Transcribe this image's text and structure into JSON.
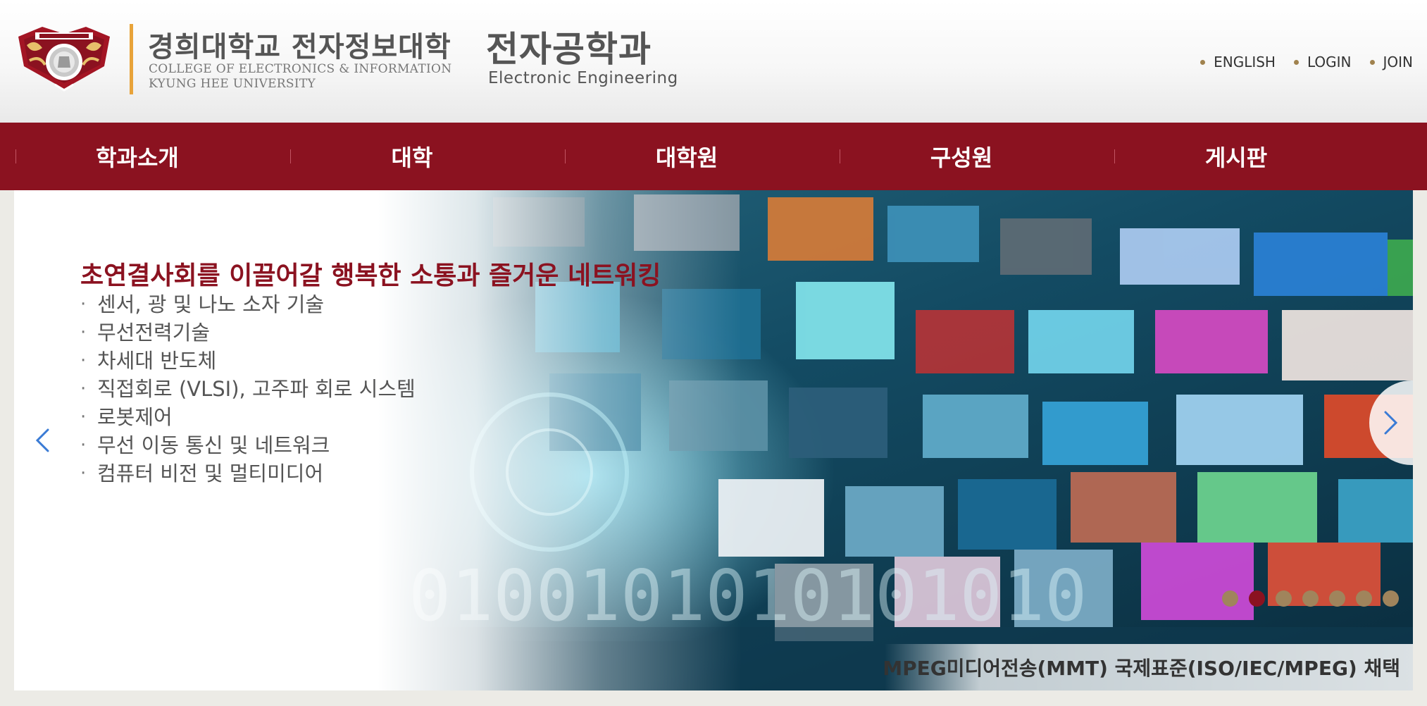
{
  "header": {
    "college_ko": "경희대학교 전자정보대학",
    "college_en_line1": "COLLEGE OF ELECTRONICS & INFORMATION",
    "college_en_line2": "KYUNG HEE UNIVERSITY",
    "dept_ko": "전자공학과",
    "dept_en": "Electronic  Engineering",
    "util_links": [
      "ENGLISH",
      "LOGIN",
      "JOIN"
    ]
  },
  "gnb": {
    "items": [
      "학과소개",
      "대학",
      "대학원",
      "구성원",
      "게시판"
    ]
  },
  "hero": {
    "title": "초연결사회를 이끌어갈 행복한 소통과 즐거운 네트워킹",
    "items": [
      "센서, 광 및 나노 소자 기술",
      "무선전력기술",
      "차세대 반도체",
      "직접회로 (VLSI), 고주파 회로 시스템",
      "로봇제어",
      "무선 이동 통신 및 네트워크",
      "컴퓨터 비전 및 멀티미디어"
    ],
    "caption": "MPEG미디어전송(MMT) 국제표준(ISO/IEC/MPEG) 채택",
    "pager": {
      "count": 7,
      "active": 2
    },
    "background_binary": "0100101010101010"
  },
  "colors": {
    "brand_red": "#8b1220",
    "gold": "#a0845c",
    "logo_bar": "#e8a33a"
  },
  "icons": {
    "prev": "chevron-left-icon",
    "next": "chevron-right-icon",
    "emblem": "university-emblem-icon"
  }
}
